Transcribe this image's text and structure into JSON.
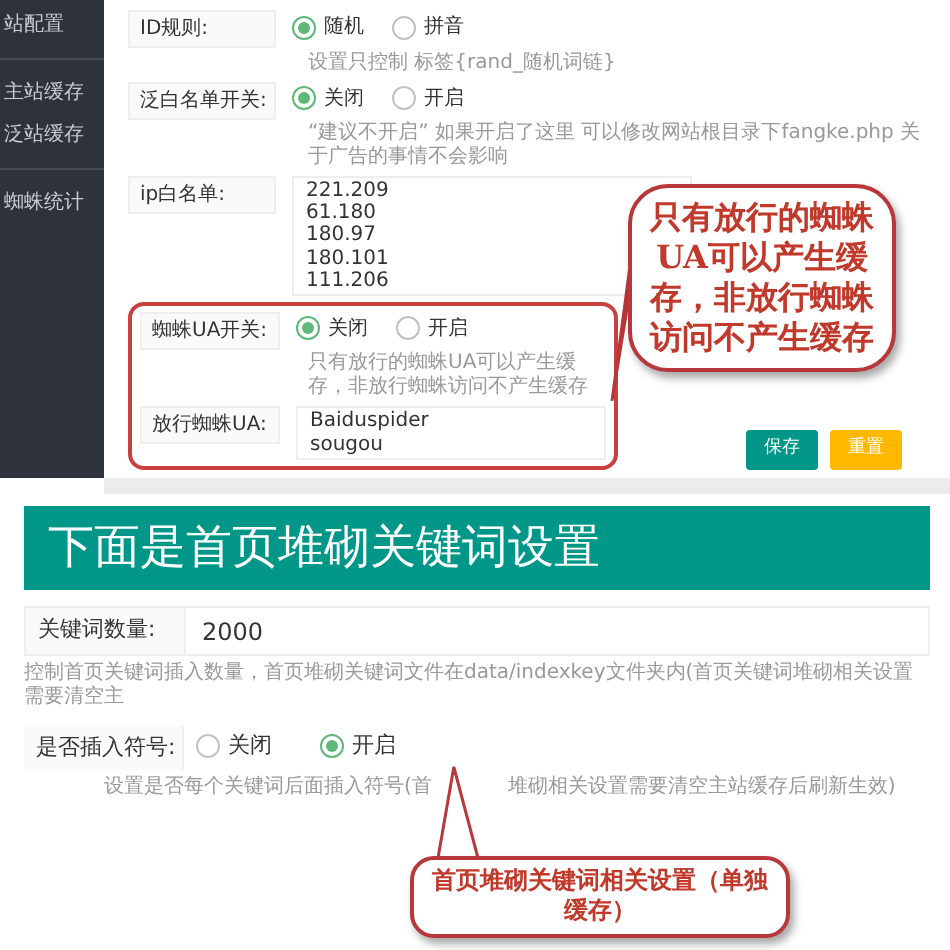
{
  "sidebar": {
    "items": [
      {
        "label": "站配置"
      },
      {
        "label": "主站缓存"
      },
      {
        "label": "泛站缓存"
      },
      {
        "label": "蜘蛛统计"
      }
    ]
  },
  "spider_settings": {
    "fields": [
      {
        "kind": "radio",
        "label": "ID规则:",
        "options": [
          {
            "label": "随机",
            "selected": true
          },
          {
            "label": "拼音",
            "selected": false
          }
        ],
        "hint": "设置只控制 标签{rand_随机词链}"
      },
      {
        "kind": "radio",
        "label": "泛白名单开关:",
        "options": [
          {
            "label": "关闭",
            "selected": true
          },
          {
            "label": "开启",
            "selected": false
          }
        ],
        "hint": "“建议不开启” 如果开启了这里 可以修改网站根目录下fangke.php 关于广告的事情不会影响"
      },
      {
        "kind": "textarea",
        "label": "ip白名单:",
        "lines": [
          "221.209",
          "61.180",
          "180.97",
          "180.101",
          "111.206"
        ]
      }
    ],
    "highlighted_section": {
      "fields": [
        {
          "kind": "radio",
          "label": "蜘蛛UA开关:",
          "options": [
            {
              "label": "关闭",
              "selected": true
            },
            {
              "label": "开启",
              "selected": false
            }
          ],
          "hint": "只有放行的蜘蛛UA可以产生缓存，非放行蜘蛛访问不产生缓存"
        },
        {
          "kind": "textarea",
          "label": "放行蜘蛛UA:",
          "lines": [
            "Baiduspider",
            "sougou"
          ]
        }
      ]
    },
    "buttons": [
      {
        "label": "保存",
        "kind": "primary"
      },
      {
        "label": "重置",
        "kind": "warning"
      }
    ]
  },
  "keyword_section": {
    "banner": "下面是首页堆砌关键词设置",
    "fields": [
      {
        "kind": "input",
        "label": "关键词数量:",
        "value": "2000",
        "hint": "控制首页关键词插入数量，首页堆砌关键词文件在data/indexkey文件夹内(首页关键词堆砌相关设置需要清空主"
      },
      {
        "kind": "radio",
        "label": "是否插入符号:",
        "options": [
          {
            "label": "关闭",
            "selected": false
          },
          {
            "label": "开启",
            "selected": true
          }
        ],
        "hint_parts": [
          "设置是否每个关键词后面插入符号(首",
          "堆砌相关设置需要清空主站缓存后刷新生效)"
        ]
      }
    ]
  },
  "annotations": [
    {
      "kind": "callout",
      "text": "只有放行的蜘蛛UA可以产生缓存，非放行蜘蛛访问不产生缓存"
    },
    {
      "kind": "callout",
      "text": "首页堆砌关键词相关设置（单独缓存）"
    }
  ]
}
